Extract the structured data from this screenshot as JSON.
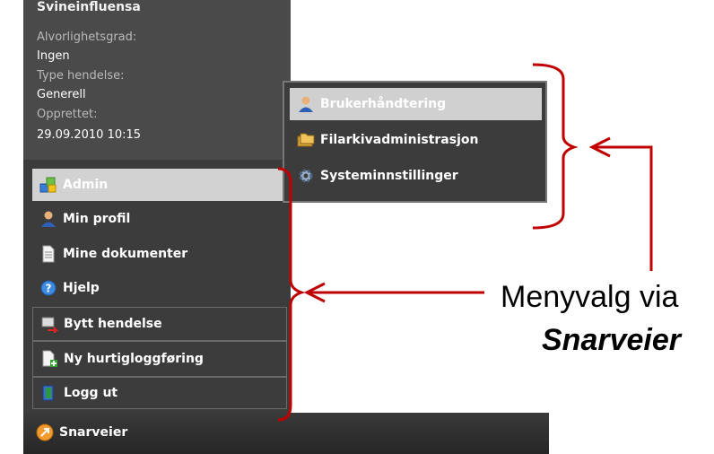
{
  "info_panel": {
    "name": "Svineinfluensa",
    "severity_label": "Alvorlighetsgrad:",
    "severity_value": "Ingen",
    "type_label": "Type hendelse:",
    "type_value": "Generell",
    "created_label": "Opprettet:",
    "created_value": "29.09.2010 10:15"
  },
  "main_menu": {
    "items": [
      {
        "label": "Admin",
        "icon": "admin-blocks-icon"
      },
      {
        "label": "Min profil",
        "icon": "user-icon"
      },
      {
        "label": "Mine dokumenter",
        "icon": "document-icon"
      },
      {
        "label": "Hjelp",
        "icon": "help-icon"
      },
      {
        "label": "Bytt hendelse",
        "icon": "switch-event-icon"
      },
      {
        "label": "Ny hurtigloggføring",
        "icon": "new-quicklog-icon"
      },
      {
        "label": "Logg ut",
        "icon": "logout-icon"
      }
    ]
  },
  "submenu": {
    "items": [
      {
        "label": "Brukerhåndtering",
        "icon": "user-icon"
      },
      {
        "label": "Filarkivadministrasjon",
        "icon": "folders-icon"
      },
      {
        "label": "Systeminnstillinger",
        "icon": "gear-icon"
      }
    ]
  },
  "taskbar": {
    "shortcuts_label": "Snarveier"
  },
  "annotation": {
    "line1": "Menyvalg via",
    "line2": "Snarveier",
    "color": "#c00000"
  }
}
